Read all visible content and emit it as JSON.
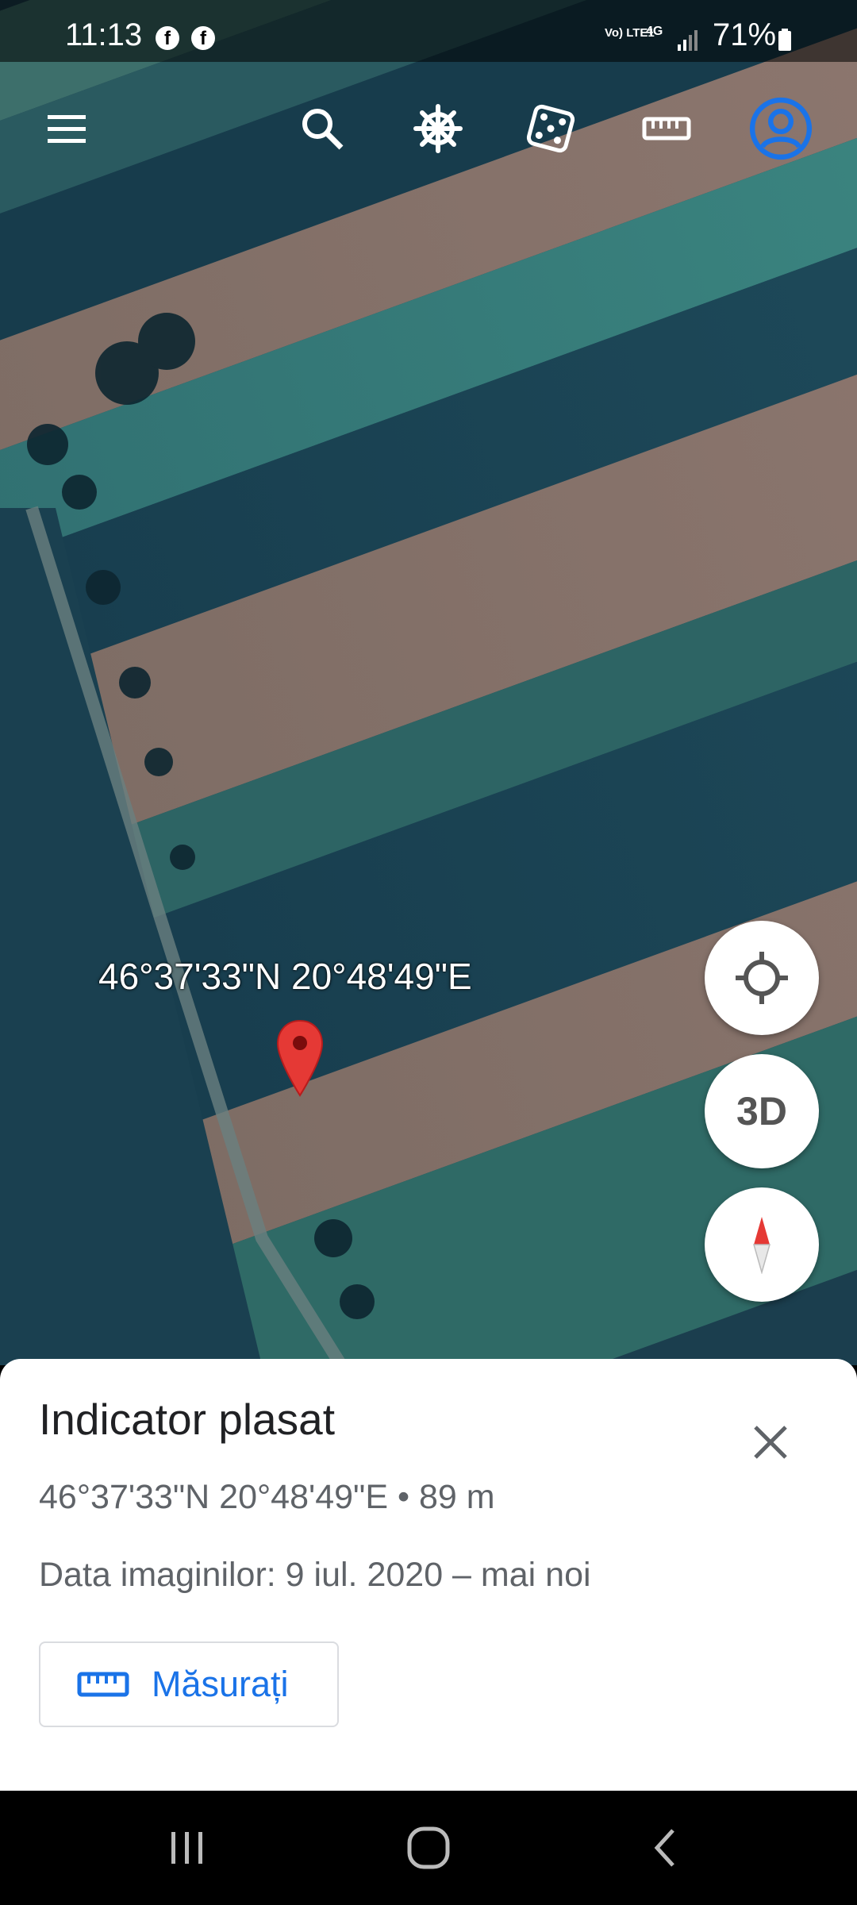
{
  "status_bar": {
    "time": "11:13",
    "network_label": "Vo) LTE1",
    "network_type": "4G",
    "battery_percent": "71%",
    "notification_icons": [
      "facebook-icon",
      "facebook-icon"
    ]
  },
  "toolbar": {
    "icons": [
      "menu-icon",
      "search-icon",
      "voyager-wheel-icon",
      "dice-icon",
      "ruler-icon",
      "account-icon"
    ],
    "account_color": "#1a73e8"
  },
  "map": {
    "pin_label": "46°37'33\"N 20°48'49\"E",
    "pin_color": "#e53935",
    "controls": {
      "location_icon": "crosshair-icon",
      "threed_label": "3D",
      "compass_icon": "compass-icon"
    }
  },
  "sheet": {
    "title": "Indicator plasat",
    "coords": "46°37'33\"N 20°48'49\"E • 89 m",
    "imagery_date": "Data imaginilor: 9 iul. 2020 – mai noi",
    "measure_label": "Măsurați",
    "accent_color": "#1a73e8"
  },
  "nav_bar": {
    "icons": [
      "recents-icon",
      "home-icon",
      "back-icon"
    ]
  }
}
